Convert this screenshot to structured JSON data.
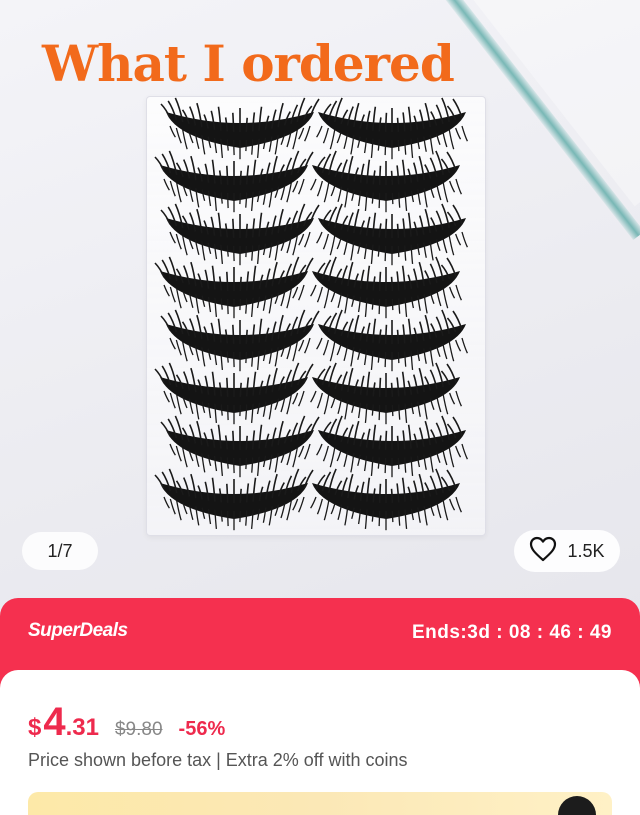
{
  "gallery": {
    "overlay_text": "What I ordered",
    "counter": "1/7",
    "likes": "1.5K"
  },
  "deal": {
    "brand": "SuperDeals",
    "timer": "Ends:3d : 08 : 46 : 49"
  },
  "price": {
    "currency": "$",
    "main": "4",
    "cents": ".31",
    "original": "$9.80",
    "discount": "-56%",
    "note": "Price shown before tax | Extra 2% off with coins"
  },
  "icons": {
    "like": "heart-outline-icon"
  },
  "colors": {
    "accent": "#f5304f",
    "price": "#ee2a4d",
    "overlay_title": "#f26a1b"
  }
}
